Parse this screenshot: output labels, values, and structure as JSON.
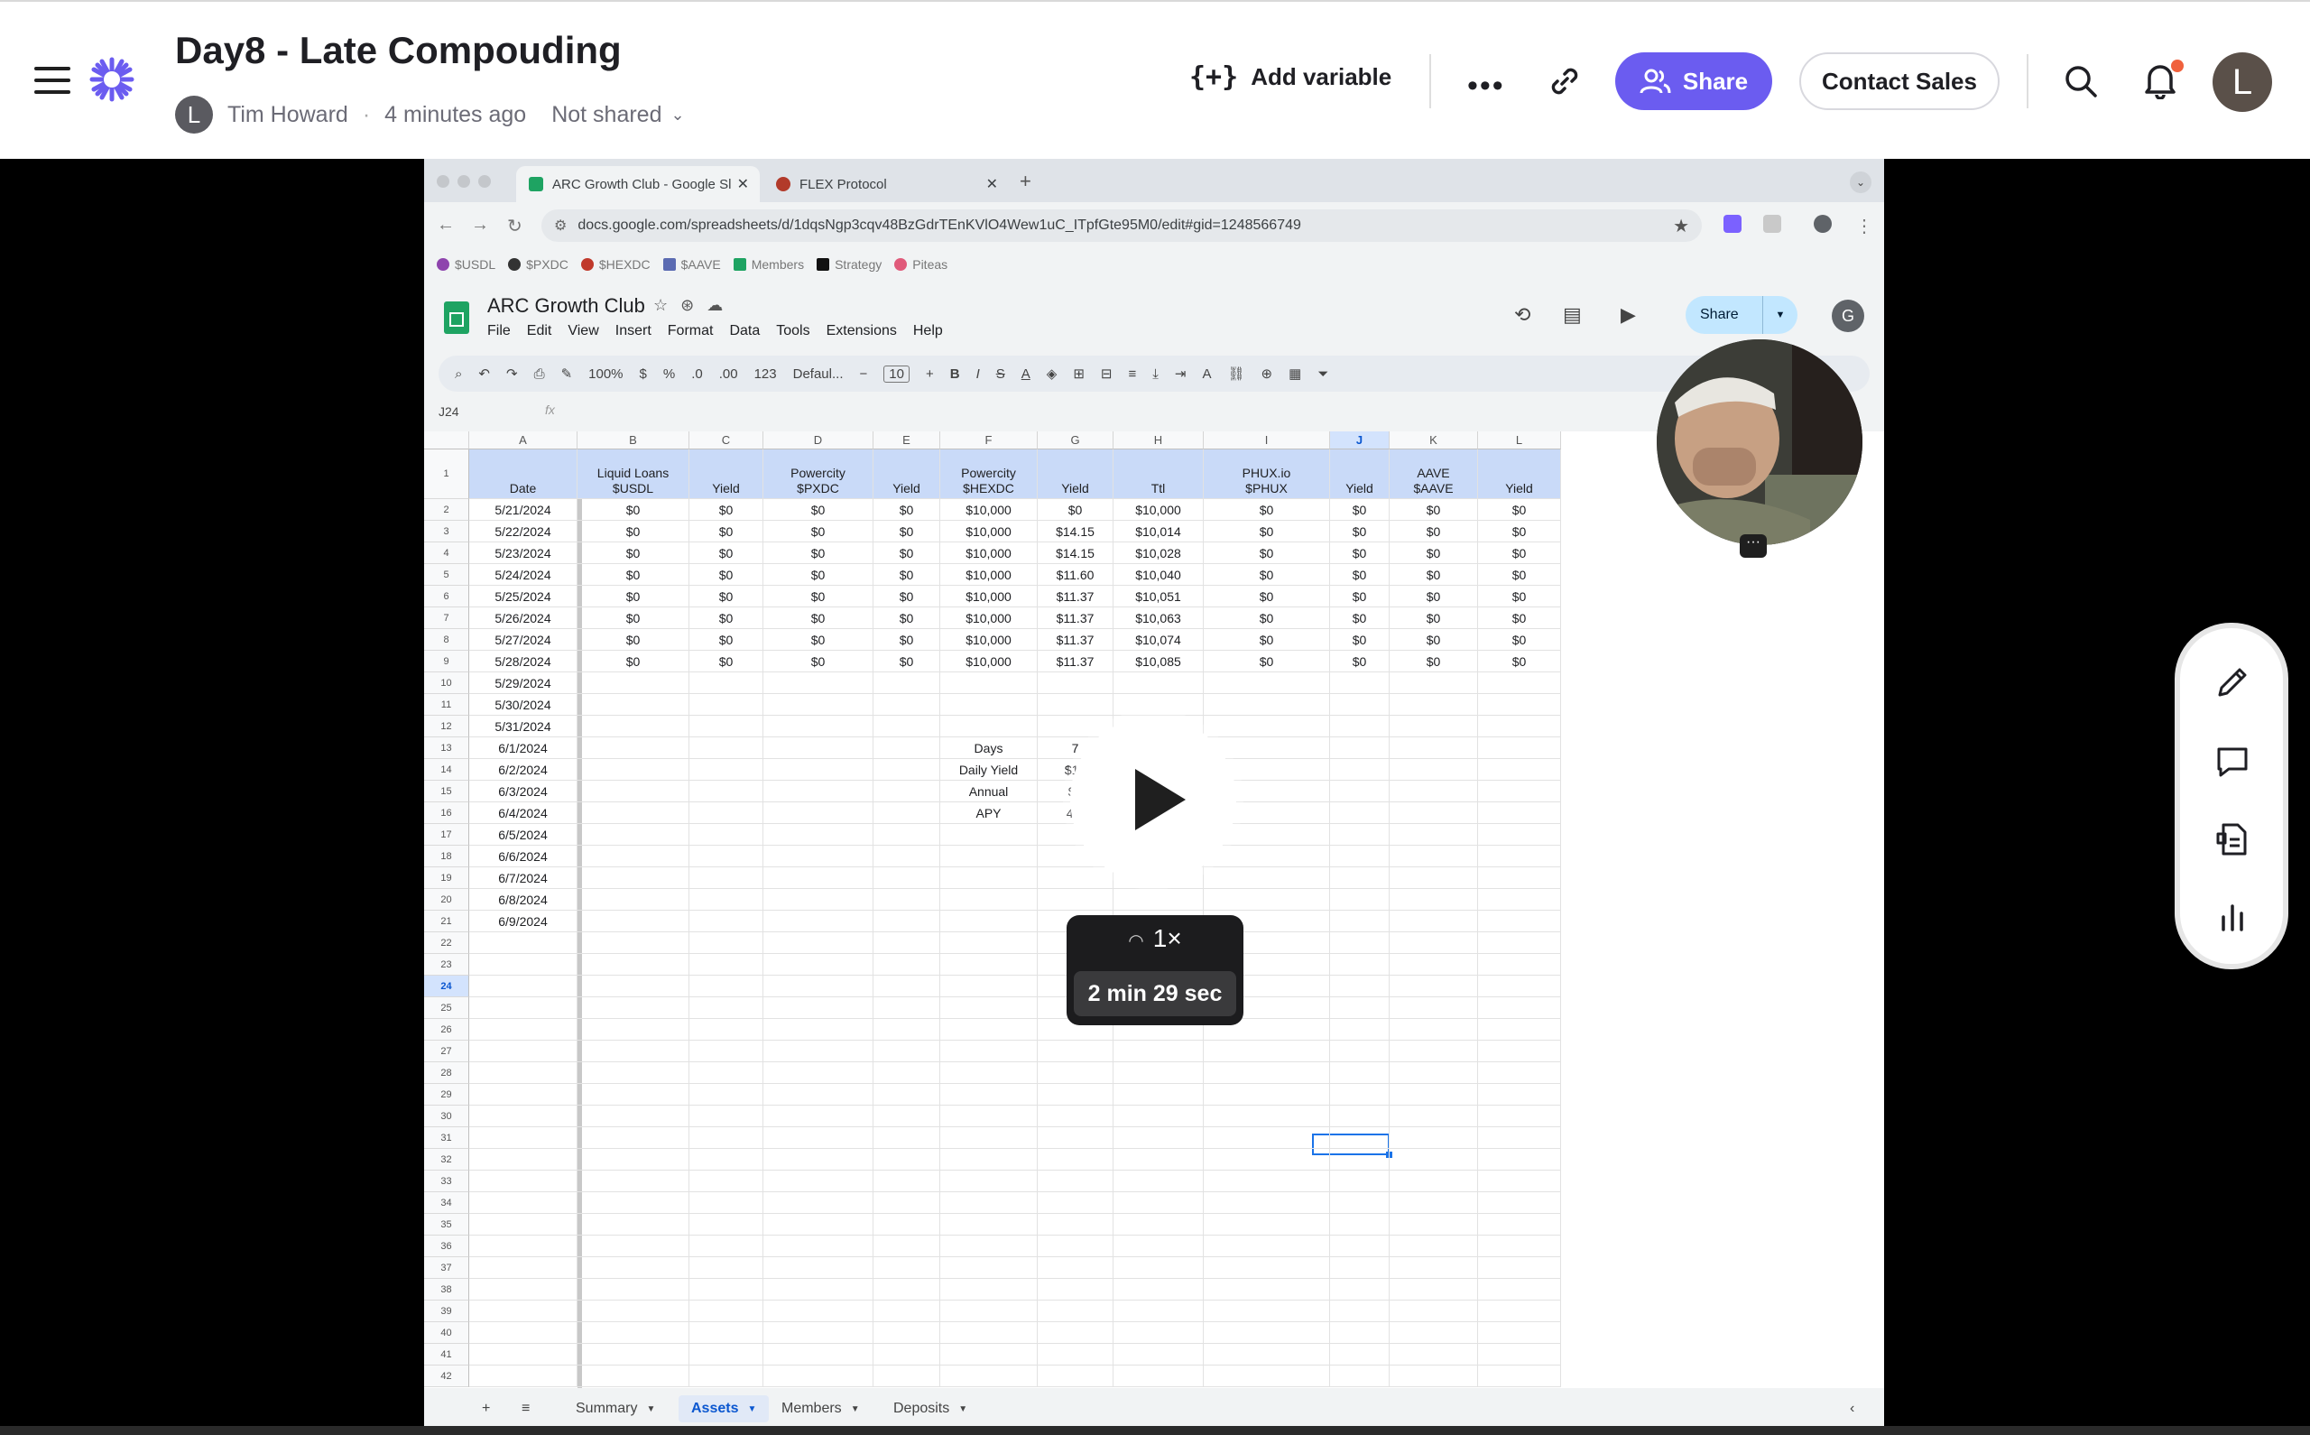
{
  "header": {
    "title": "Day8 - Late Compouding",
    "author_initial": "L",
    "author": "Tim Howard",
    "time": "4 minutes ago",
    "share_status": "Not shared",
    "add_variable": "Add variable",
    "share": "Share",
    "contact_sales": "Contact Sales",
    "user_initial": "L",
    "colors": {
      "accent": "#6b5cf0",
      "notification": "#f0613d"
    }
  },
  "browser": {
    "tabs": [
      {
        "label": "ARC Growth Club - Google Sl",
        "active": true
      },
      {
        "label": "FLEX Protocol",
        "active": false
      }
    ],
    "url": "docs.google.com/spreadsheets/d/1dqsNgp3cqv48BzGdrTEnKVlO4Wew1uC_ITpfGte95M0/edit#gid=1248566749",
    "bookmarks": [
      "$USDL",
      "$PXDC",
      "$HEXDC",
      "$AAVE",
      "Members",
      "Strategy",
      "Piteas"
    ]
  },
  "sheet": {
    "doc_title": "ARC Growth Club",
    "menus": [
      "File",
      "Edit",
      "View",
      "Insert",
      "Format",
      "Data",
      "Tools",
      "Extensions",
      "Help"
    ],
    "share": "Share",
    "account_initial": "G",
    "toolbar": {
      "zoom": "100%",
      "currency": "$",
      "percent": "%",
      "dec_minus": ".0",
      "dec_plus": ".00",
      "number": "123",
      "font": "Defaul...",
      "font_size": "10"
    },
    "cell_ref": "J24",
    "fx": "fx",
    "columns": [
      "A",
      "B",
      "C",
      "D",
      "E",
      "F",
      "G",
      "H",
      "I",
      "J",
      "K",
      "L"
    ],
    "headers": [
      "Date",
      "Liquid Loans\n$USDL",
      "Yield",
      "Powercity\n$PXDC",
      "Yield",
      "Powercity\n$HEXDC",
      "Yield",
      "Ttl",
      "PHUX.io\n$PHUX",
      "Yield",
      "AAVE\n$AAVE",
      "Yield"
    ],
    "rows": [
      [
        "5/21/2024",
        "$0",
        "$0",
        "$0",
        "$0",
        "$10,000",
        "$0",
        "$10,000",
        "$0",
        "$0",
        "$0",
        "$0"
      ],
      [
        "5/22/2024",
        "$0",
        "$0",
        "$0",
        "$0",
        "$10,000",
        "$14.15",
        "$10,014",
        "$0",
        "$0",
        "$0",
        "$0"
      ],
      [
        "5/23/2024",
        "$0",
        "$0",
        "$0",
        "$0",
        "$10,000",
        "$14.15",
        "$10,028",
        "$0",
        "$0",
        "$0",
        "$0"
      ],
      [
        "5/24/2024",
        "$0",
        "$0",
        "$0",
        "$0",
        "$10,000",
        "$11.60",
        "$10,040",
        "$0",
        "$0",
        "$0",
        "$0"
      ],
      [
        "5/25/2024",
        "$0",
        "$0",
        "$0",
        "$0",
        "$10,000",
        "$11.37",
        "$10,051",
        "$0",
        "$0",
        "$0",
        "$0"
      ],
      [
        "5/26/2024",
        "$0",
        "$0",
        "$0",
        "$0",
        "$10,000",
        "$11.37",
        "$10,063",
        "$0",
        "$0",
        "$0",
        "$0"
      ],
      [
        "5/27/2024",
        "$0",
        "$0",
        "$0",
        "$0",
        "$10,000",
        "$11.37",
        "$10,074",
        "$0",
        "$0",
        "$0",
        "$0"
      ],
      [
        "5/28/2024",
        "$0",
        "$0",
        "$0",
        "$0",
        "$10,000",
        "$11.37",
        "$10,085",
        "$0",
        "$0",
        "$0",
        "$0"
      ],
      [
        "5/29/2024"
      ],
      [
        "5/30/2024"
      ],
      [
        "5/31/2024"
      ],
      [
        "6/1/2024",
        "",
        "",
        "",
        "",
        "Days",
        "7"
      ],
      [
        "6/2/2024",
        "",
        "",
        "",
        "",
        "Daily Yield",
        "$12"
      ],
      [
        "6/3/2024",
        "",
        "",
        "",
        "",
        "Annual",
        "$4"
      ],
      [
        "6/4/2024",
        "",
        "",
        "",
        "",
        "APY",
        "44."
      ],
      [
        "6/5/2024"
      ],
      [
        "6/6/2024"
      ],
      [
        "6/7/2024"
      ],
      [
        "6/8/2024"
      ],
      [
        "6/9/2024"
      ]
    ],
    "row_count": 42,
    "selected_row": 24,
    "selected_col": "J",
    "tabs": [
      "Summary",
      "Assets",
      "Members",
      "Deposits"
    ],
    "active_tab": "Assets"
  },
  "player": {
    "speed": "1×",
    "duration": "2 min 29 sec"
  },
  "tools": [
    "pencil-icon",
    "comment-icon",
    "transcript-icon",
    "insights-icon"
  ]
}
